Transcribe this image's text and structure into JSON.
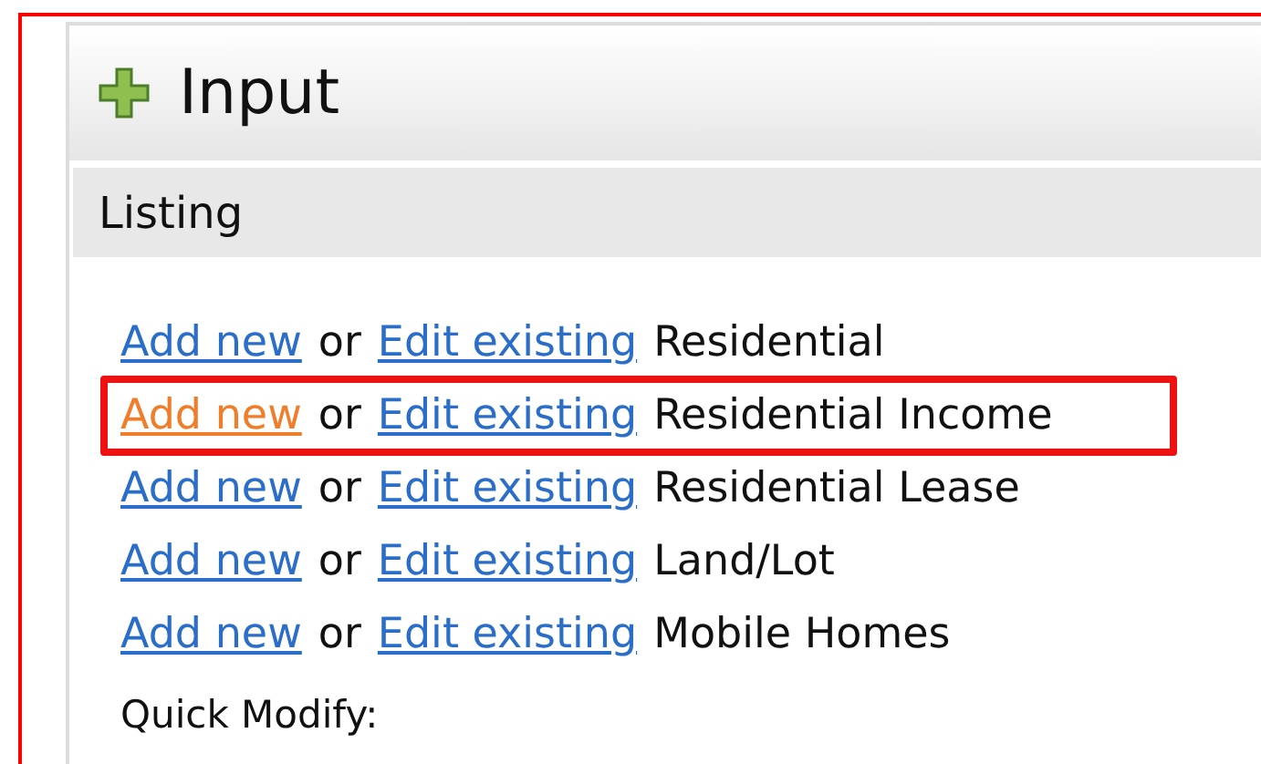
{
  "header": {
    "title": "Input"
  },
  "section": {
    "title": "Listing"
  },
  "rows": [
    {
      "add_link": "Add new",
      "add_hovered": false,
      "joiner": "or",
      "edit_link": "Edit existing",
      "type": "Residential",
      "highlighted": false
    },
    {
      "add_link": "Add new",
      "add_hovered": true,
      "joiner": "or",
      "edit_link": "Edit existing",
      "type": "Residential Income",
      "highlighted": true
    },
    {
      "add_link": "Add new",
      "add_hovered": false,
      "joiner": "or",
      "edit_link": "Edit existing",
      "type": "Residential Lease",
      "highlighted": false
    },
    {
      "add_link": "Add new",
      "add_hovered": false,
      "joiner": "or",
      "edit_link": "Edit existing",
      "type": "Land/Lot",
      "highlighted": false
    },
    {
      "add_link": "Add new",
      "add_hovered": false,
      "joiner": "or",
      "edit_link": "Edit existing",
      "type": "Mobile Homes",
      "highlighted": false
    }
  ],
  "footer_label": "Quick Modify:"
}
